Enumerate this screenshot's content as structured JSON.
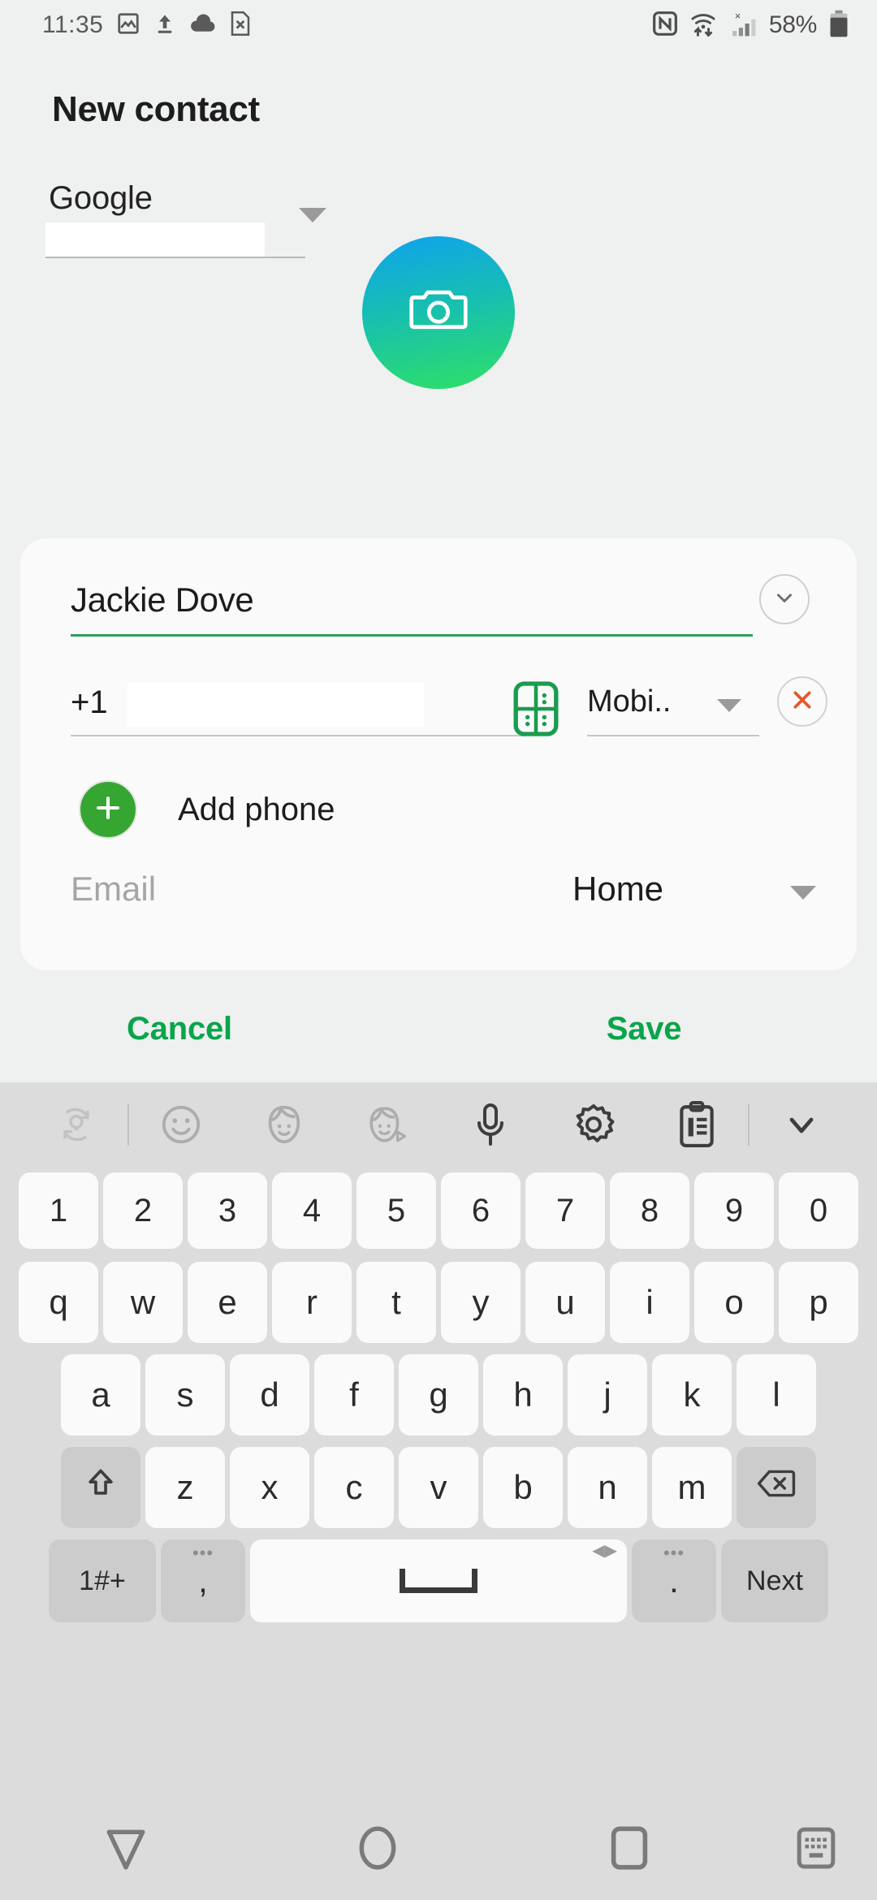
{
  "status_bar": {
    "time": "11:35",
    "left_icons": [
      "photo-icon",
      "upload-icon",
      "cloud-icon",
      "file-x-icon"
    ],
    "right_icons": [
      "nfc-icon",
      "wifi-transfer-icon",
      "signal-no-service-icon"
    ],
    "battery_percent": "58%",
    "battery_icon": "battery-icon"
  },
  "header": {
    "title": "New contact"
  },
  "account": {
    "name": "Google",
    "email_value": "",
    "caret_icon": "chevron-down-icon"
  },
  "avatar": {
    "icon": "camera-icon",
    "gradient_from": "#0fa2ef",
    "gradient_to": "#2fe065"
  },
  "form": {
    "name_field": {
      "value": "Jackie Dove",
      "underline_color": "#28a05a",
      "expand_icon": "chevron-down-icon"
    },
    "phone_field": {
      "country_prefix": "+1",
      "number_value": "",
      "sim_icon": "sim-keypad-icon",
      "type_label": "Mobi..",
      "type_caret_icon": "chevron-down-icon",
      "remove_icon": "close-x-icon",
      "remove_color": "#e8562c"
    },
    "add_phone": {
      "label": "Add phone",
      "icon": "plus-icon",
      "button_color": "#35a631"
    },
    "email_field": {
      "placeholder": "Email",
      "type_label": "Home",
      "type_caret_icon": "chevron-down-icon"
    }
  },
  "actions": {
    "cancel_label": "Cancel",
    "save_label": "Save",
    "accent_color": "#09a54a"
  },
  "keyboard": {
    "toolbar": [
      {
        "name": "predictive-text-icon"
      },
      {
        "name": "divider"
      },
      {
        "name": "emoji-icon"
      },
      {
        "name": "ar-emoji-icon"
      },
      {
        "name": "ar-emoji-camera-icon"
      },
      {
        "name": "microphone-icon"
      },
      {
        "name": "settings-gear-icon"
      },
      {
        "name": "clipboard-icon"
      },
      {
        "name": "divider"
      },
      {
        "name": "collapse-keyboard-icon"
      }
    ],
    "row_numbers": [
      "1",
      "2",
      "3",
      "4",
      "5",
      "6",
      "7",
      "8",
      "9",
      "0"
    ],
    "row_q": [
      "q",
      "w",
      "e",
      "r",
      "t",
      "y",
      "u",
      "i",
      "o",
      "p"
    ],
    "row_a": [
      "a",
      "s",
      "d",
      "f",
      "g",
      "h",
      "j",
      "k",
      "l"
    ],
    "row_z": [
      "z",
      "x",
      "c",
      "v",
      "b",
      "n",
      "m"
    ],
    "shift_icon": "shift-arrow-icon",
    "backspace_icon": "backspace-icon",
    "symbols_label": "1#+",
    "comma_label": ",",
    "comma_dots": "•••",
    "space_label": "",
    "space_arrows": "◀▶",
    "period_label": ".",
    "period_dots": "•••",
    "next_label": "Next"
  },
  "nav_bar": {
    "back_icon": "back-triangle-icon",
    "home_icon": "home-circle-icon",
    "recents_icon": "recents-square-icon",
    "hide_keyboard_icon": "hide-keyboard-icon"
  }
}
